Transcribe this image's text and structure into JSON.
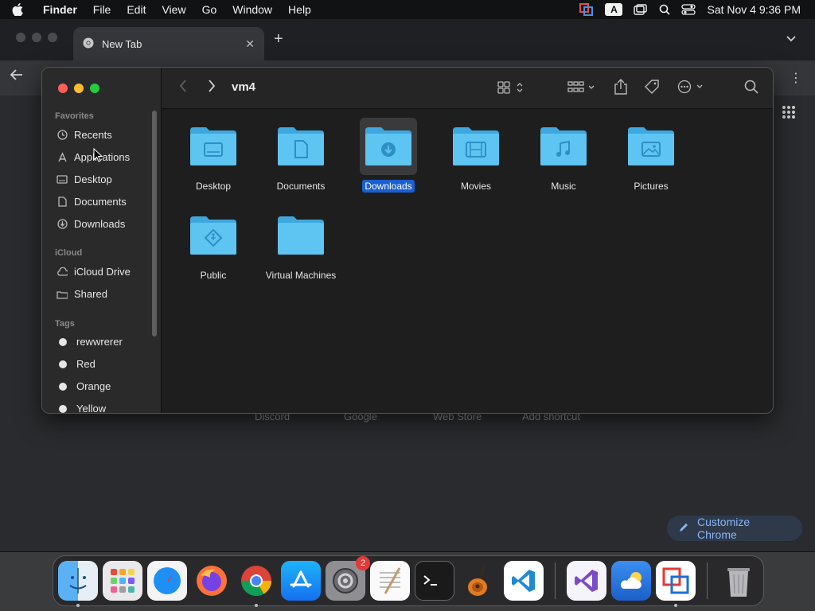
{
  "menubar": {
    "app": "Finder",
    "items": [
      "File",
      "Edit",
      "View",
      "Go",
      "Window",
      "Help"
    ],
    "clock": "Sat Nov 4  9:36 PM",
    "input_source": "A"
  },
  "browser": {
    "tab_title": "New Tab",
    "shortcuts": [
      "Discord",
      "Google",
      "Web Store",
      "Add shortcut"
    ],
    "customize_label": "Customize Chrome"
  },
  "finder": {
    "title": "vm4",
    "sidebar": {
      "favorites_label": "Favorites",
      "favorites": [
        "Recents",
        "Applications",
        "Desktop",
        "Documents",
        "Downloads"
      ],
      "icloud_label": "iCloud",
      "icloud": [
        "iCloud Drive",
        "Shared"
      ],
      "tags_label": "Tags",
      "tags": [
        "rewwrerer",
        "Red",
        "Orange",
        "Yellow"
      ]
    },
    "items": [
      {
        "name": "Desktop",
        "icon": "desktop-folder-icon",
        "selected": false
      },
      {
        "name": "Documents",
        "icon": "documents-folder-icon",
        "selected": false
      },
      {
        "name": "Downloads",
        "icon": "downloads-folder-icon",
        "selected": true
      },
      {
        "name": "Movies",
        "icon": "movies-folder-icon",
        "selected": false
      },
      {
        "name": "Music",
        "icon": "music-folder-icon",
        "selected": false
      },
      {
        "name": "Pictures",
        "icon": "pictures-folder-icon",
        "selected": false
      },
      {
        "name": "Public",
        "icon": "public-folder-icon",
        "selected": false
      },
      {
        "name": "Virtual Machines",
        "icon": "folder-icon",
        "selected": false
      }
    ]
  },
  "dock": {
    "settings_badge": "2"
  },
  "colors": {
    "folder": "#5ec4f2",
    "selection": "#1a5fd1",
    "accent_link": "#8ab4f8"
  }
}
